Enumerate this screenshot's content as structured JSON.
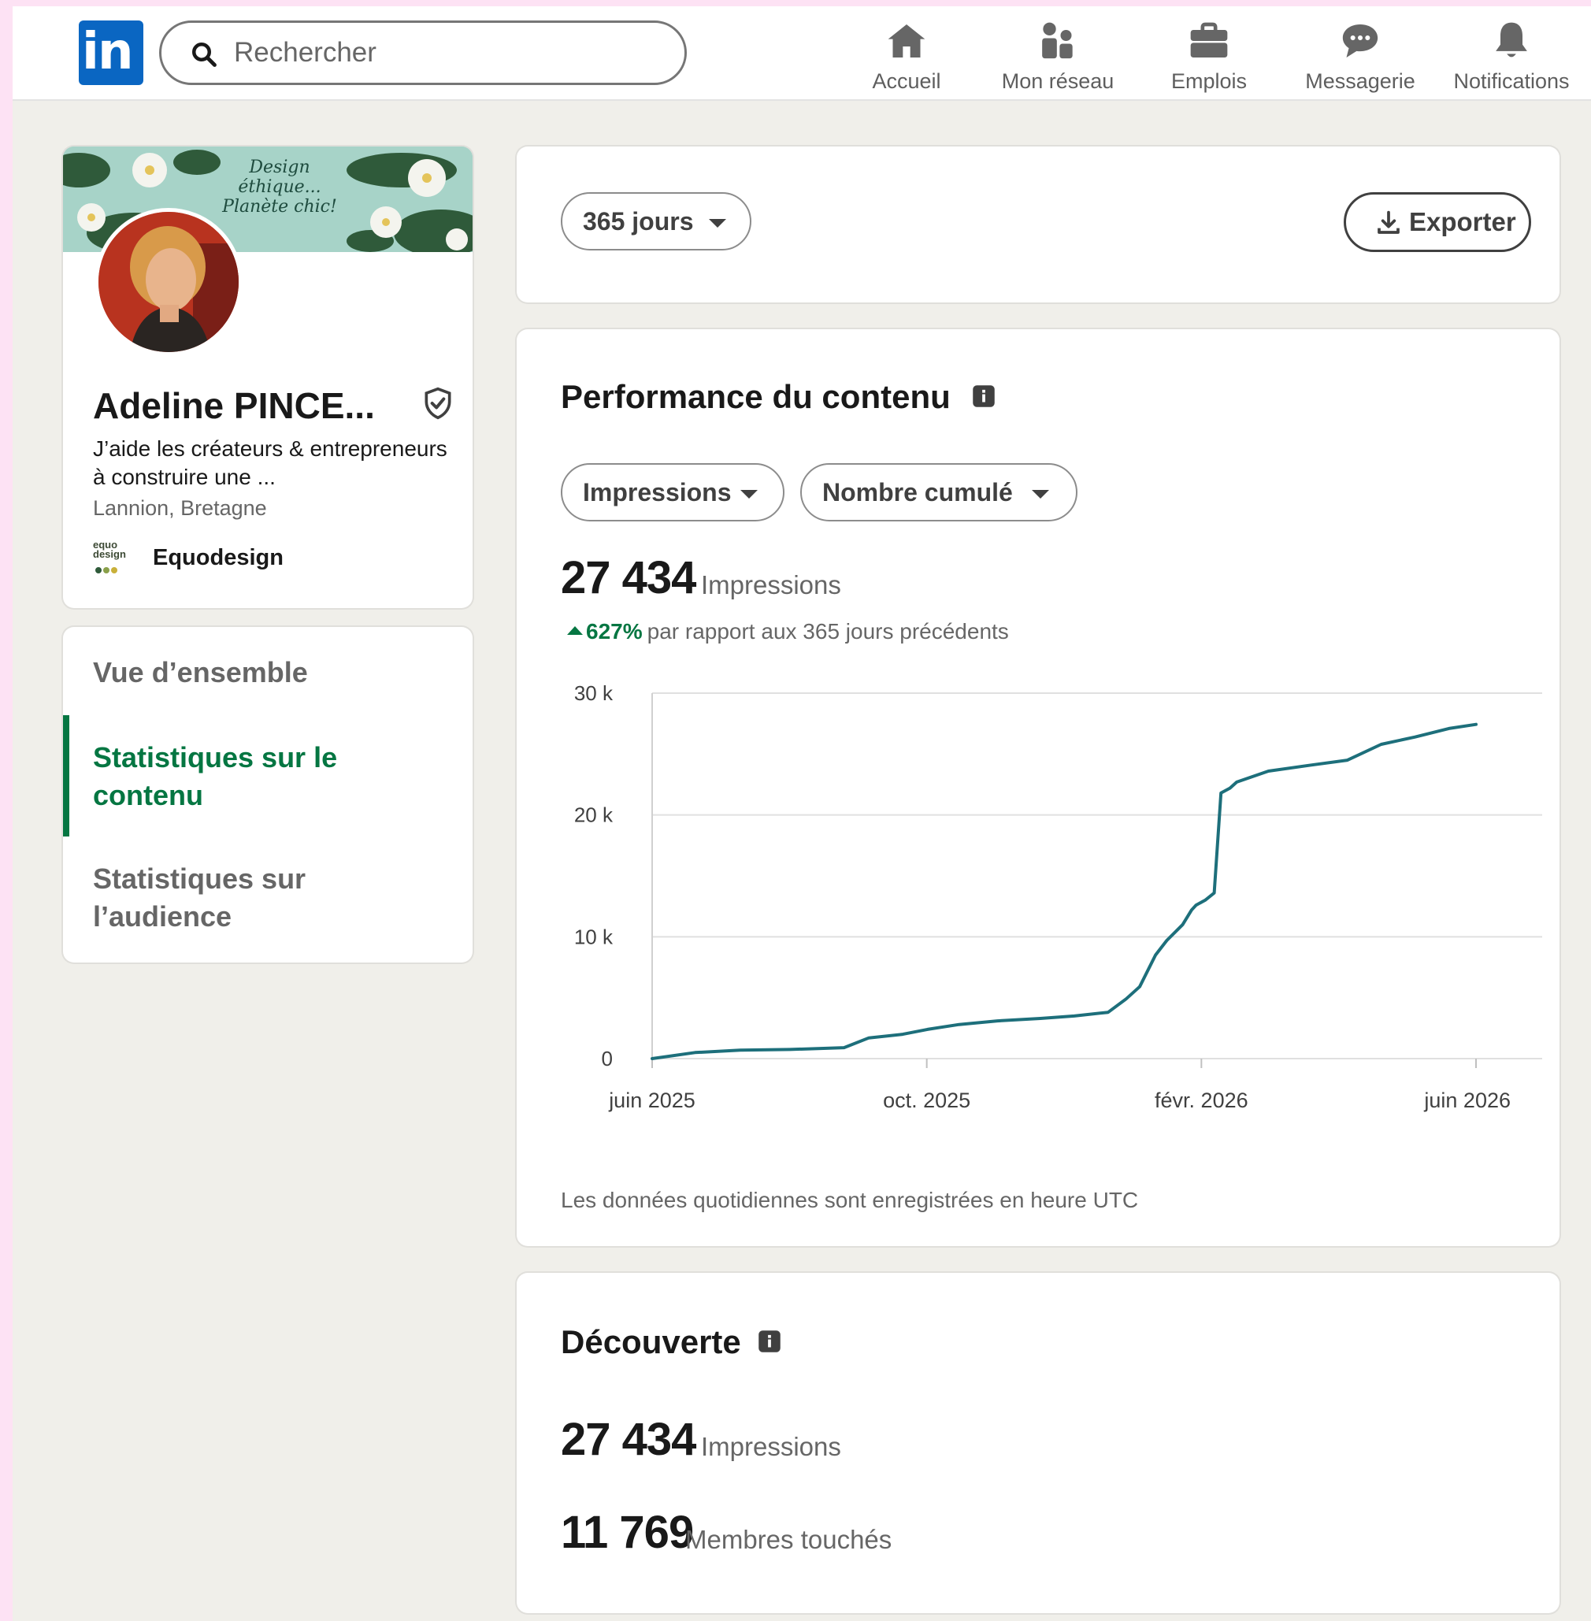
{
  "nav": {
    "search_placeholder": "Rechercher",
    "items": [
      {
        "label": "Accueil",
        "icon": "home-icon"
      },
      {
        "label": "Mon réseau",
        "icon": "network-icon"
      },
      {
        "label": "Emplois",
        "icon": "briefcase-icon"
      },
      {
        "label": "Messagerie",
        "icon": "messaging-icon"
      },
      {
        "label": "Notifications",
        "icon": "bell-icon"
      }
    ]
  },
  "profile": {
    "banner_text": "Design éthique... Planète chic!",
    "name": "Adeline PINCE...",
    "headline": "J’aide les créateurs & entrepreneurs à construire une ...",
    "location": "Lannion, Bretagne",
    "company": "Equodesign",
    "company_logo_text": "equo design"
  },
  "side_nav": {
    "items": [
      {
        "label": "Vue d’ensemble",
        "active": false
      },
      {
        "label": "Statistiques sur le contenu",
        "active": true
      },
      {
        "label": "Statistiques sur l’audience",
        "active": false
      }
    ]
  },
  "filters": {
    "period": "365 jours",
    "export_label": "Exporter"
  },
  "performance": {
    "title": "Performance du contenu",
    "metric_dropdown": "Impressions",
    "mode_dropdown": "Nombre cumulé",
    "total": "27 434",
    "total_unit": "Impressions",
    "change_pct": "627%",
    "change_text": "par rapport aux 365 jours précédents",
    "footnote": "Les données quotidiennes sont enregistrées en heure UTC"
  },
  "chart_data": {
    "type": "line",
    "title": "",
    "xlabel": "",
    "ylabel": "",
    "ylim": [
      0,
      30000
    ],
    "yticks": [
      "0",
      "10 k",
      "20 k",
      "30 k"
    ],
    "xticks": [
      "juin 2025",
      "oct. 2025",
      "févr. 2026",
      "juin 2026"
    ],
    "grid": true,
    "color": "#1d6f7b",
    "series": [
      {
        "x": [
          "2025-06-01",
          "2025-06-20",
          "2025-07-10",
          "2025-08-01",
          "2025-08-25",
          "2025-09-05",
          "2025-09-20",
          "2025-10-01",
          "2025-10-15",
          "2025-11-01",
          "2025-11-20",
          "2025-12-05",
          "2025-12-20",
          "2025-12-28",
          "2026-01-03",
          "2026-01-10",
          "2026-01-15",
          "2026-01-22",
          "2026-01-26",
          "2026-01-28",
          "2026-02-01",
          "2026-02-05",
          "2026-02-08",
          "2026-02-12",
          "2026-02-15",
          "2026-03-01",
          "2026-03-20",
          "2026-04-05",
          "2026-04-20",
          "2026-05-05",
          "2026-05-20",
          "2026-06-01"
        ],
        "y": [
          0,
          500,
          700,
          750,
          900,
          1700,
          2000,
          2400,
          2800,
          3100,
          3300,
          3500,
          3800,
          4900,
          5900,
          8500,
          9700,
          11000,
          12200,
          12600,
          13000,
          13600,
          21800,
          22200,
          22700,
          23600,
          24100,
          24500,
          25800,
          26400,
          27100,
          27434
        ]
      }
    ]
  },
  "discovery": {
    "title": "Découverte",
    "impressions_value": "27 434",
    "impressions_label": "Impressions",
    "members_value": "11 769",
    "members_label": "Membres touchés"
  }
}
